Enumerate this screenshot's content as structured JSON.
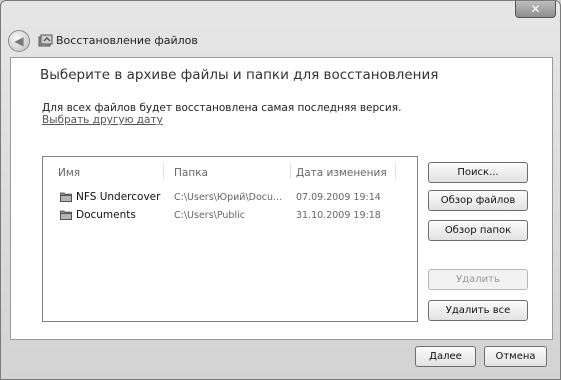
{
  "window": {
    "title": "Восстановление файлов",
    "close_label": "✕"
  },
  "content": {
    "heading": "Выберите в архиве файлы и папки для восстановления",
    "description": "Для всех файлов будет восстановлена самая последняя версия.",
    "choose_date_link": "Выбрать другую дату"
  },
  "table": {
    "columns": [
      "Имя",
      "Папка",
      "Дата изменения"
    ],
    "rows": [
      {
        "name": "NFS Undercover",
        "folder": "C:\\Users\\Юрий\\Docu...",
        "date": "07.09.2009 19:14"
      },
      {
        "name": "Documents",
        "folder": "C:\\Users\\Public",
        "date": "31.10.2009 19:18"
      }
    ]
  },
  "side_buttons": {
    "search": "Поиск...",
    "browse_files": "Обзор файлов",
    "browse_folders": "Обзор папок",
    "remove": "Удалить",
    "remove_all": "Удалить все"
  },
  "footer": {
    "next": "Далее",
    "cancel": "Отмена"
  }
}
